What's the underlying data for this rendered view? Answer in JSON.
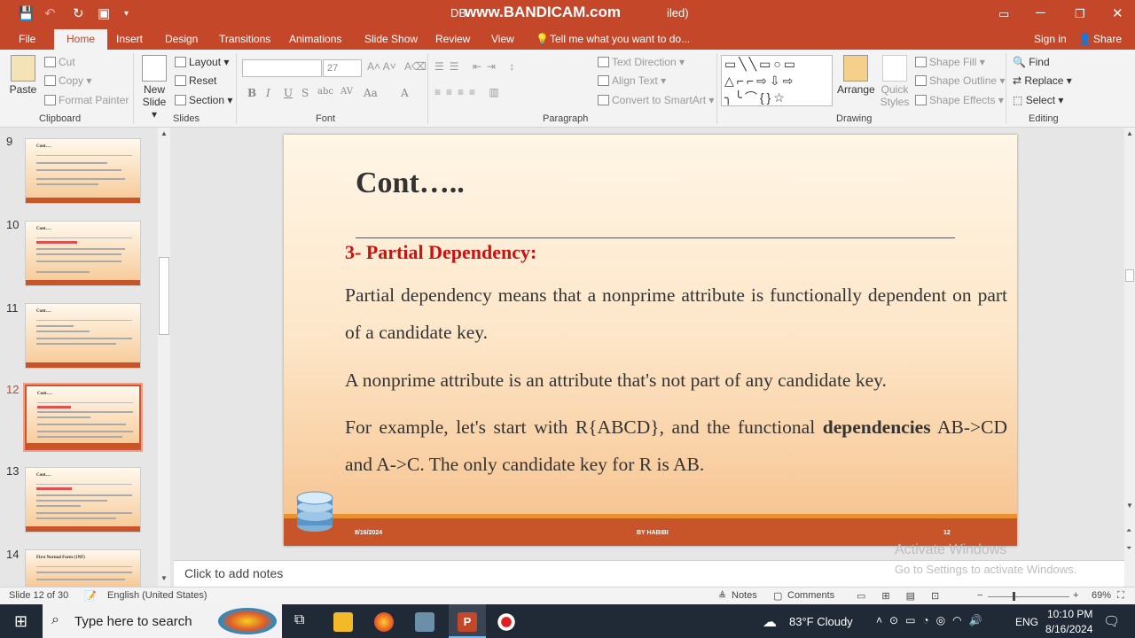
{
  "window": {
    "title": "DB",
    "title_tail": "iled)",
    "watermark": "www.BANDICAM.com",
    "signin": "Sign in",
    "share": "Share"
  },
  "tabs": [
    "File",
    "Home",
    "Insert",
    "Design",
    "Transitions",
    "Animations",
    "Slide Show",
    "Review",
    "View"
  ],
  "tell_me": "Tell me what you want to do...",
  "ribbon": {
    "clipboard": {
      "paste": "Paste",
      "cut": "Cut",
      "copy": "Copy",
      "format_painter": "Format Painter",
      "label": "Clipboard"
    },
    "slides": {
      "new_slide": "New Slide",
      "layout": "Layout",
      "reset": "Reset",
      "section": "Section",
      "label": "Slides"
    },
    "font": {
      "size": "27",
      "label": "Font"
    },
    "paragraph": {
      "text_direction": "Text Direction",
      "align_text": "Align Text",
      "convert": "Convert to SmartArt",
      "label": "Paragraph"
    },
    "drawing": {
      "arrange": "Arrange",
      "quick_styles": "Quick Styles",
      "shape_fill": "Shape Fill",
      "shape_outline": "Shape Outline",
      "shape_effects": "Shape Effects",
      "label": "Drawing"
    },
    "editing": {
      "find": "Find",
      "replace": "Replace",
      "select": "Select",
      "label": "Editing"
    }
  },
  "thumbnails": [
    {
      "num": "9",
      "title": "Cont….",
      "selected": false
    },
    {
      "num": "10",
      "title": "Cont….",
      "selected": false
    },
    {
      "num": "11",
      "title": "Cont….",
      "selected": false
    },
    {
      "num": "12",
      "title": "Cont….",
      "selected": true
    },
    {
      "num": "13",
      "title": "Cont….",
      "selected": false
    },
    {
      "num": "14",
      "title": "First Normal Form (1NF)",
      "selected": false
    }
  ],
  "slide": {
    "title": "Cont…..",
    "heading": "3- Partial Dependency:",
    "p1": "Partial dependency means that a nonprime attribute is functionally dependent on part of a candidate key.",
    "p2": "A nonprime attribute is an attribute that's not part of any candidate key.",
    "p3a": "For example, let's start with R{ABCD}, and the functional ",
    "p3b": "dependencies",
    "p3c": " AB->CD and A->C.   The only candidate key for R is AB.",
    "footer_date": "8/16/2024",
    "footer_author": "BY HABIBI",
    "footer_num": "12"
  },
  "notes_placeholder": "Click to add notes",
  "activate": {
    "line1": "Activate Windows",
    "line2": "Go to Settings to activate Windows."
  },
  "status": {
    "slide": "Slide 12 of 30",
    "lang": "English (United States)",
    "notes": "Notes",
    "comments": "Comments",
    "zoom": "69%"
  },
  "taskbar": {
    "search": "Type here to search",
    "weather": "83°F  Cloudy",
    "lang": "ENG",
    "time": "10:10 PM",
    "date": "8/16/2024"
  }
}
